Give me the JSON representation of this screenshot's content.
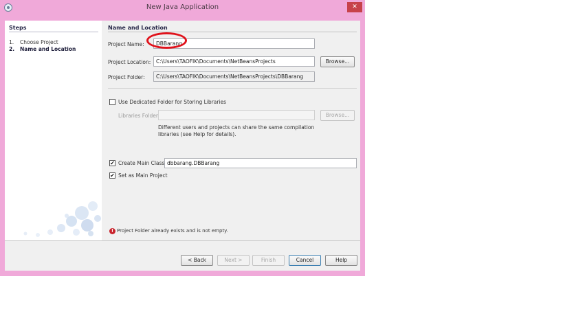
{
  "window": {
    "title": "New Java Application",
    "close_glyph": "✕"
  },
  "steps": {
    "title": "Steps",
    "items": [
      {
        "num": "1.",
        "label": "Choose Project"
      },
      {
        "num": "2.",
        "label": "Name and Location"
      }
    ]
  },
  "form": {
    "section_title": "Name and Location",
    "project_name_label": "Project Name:",
    "project_name_value": "DBBarang",
    "project_location_label": "Project Location:",
    "project_location_value": "C:\\Users\\TAOFIK\\Documents\\NetBeansProjects",
    "browse_label": "Browse...",
    "project_folder_label": "Project Folder:",
    "project_folder_value": "C:\\Users\\TAOFIK\\Documents\\NetBeansProjects\\DBBarang",
    "dedicated_folder_label": "Use Dedicated Folder for Storing Libraries",
    "libraries_folder_label": "Libraries Folder:",
    "libraries_folder_value": "",
    "libraries_browse_label": "Browse...",
    "libraries_note_line1": "Different users and projects can share the same compilation",
    "libraries_note_line2": "libraries (see Help for details).",
    "create_main_class_label": "Create Main Class",
    "main_class_value": "dbbarang.DBBarang",
    "set_main_project_label": "Set as Main Project",
    "check_glyph": "✔",
    "error_icon_glyph": "!",
    "error_message": "Project Folder already exists and is not empty."
  },
  "buttons": {
    "back": "< Back",
    "next": "Next >",
    "finish": "Finish",
    "cancel": "Cancel",
    "help": "Help"
  },
  "colors": {
    "title_bar": "#f0a9d9",
    "close_button": "#c7424a",
    "highlight_ellipse": "#e0121b",
    "error_icon": "#c8232c"
  }
}
